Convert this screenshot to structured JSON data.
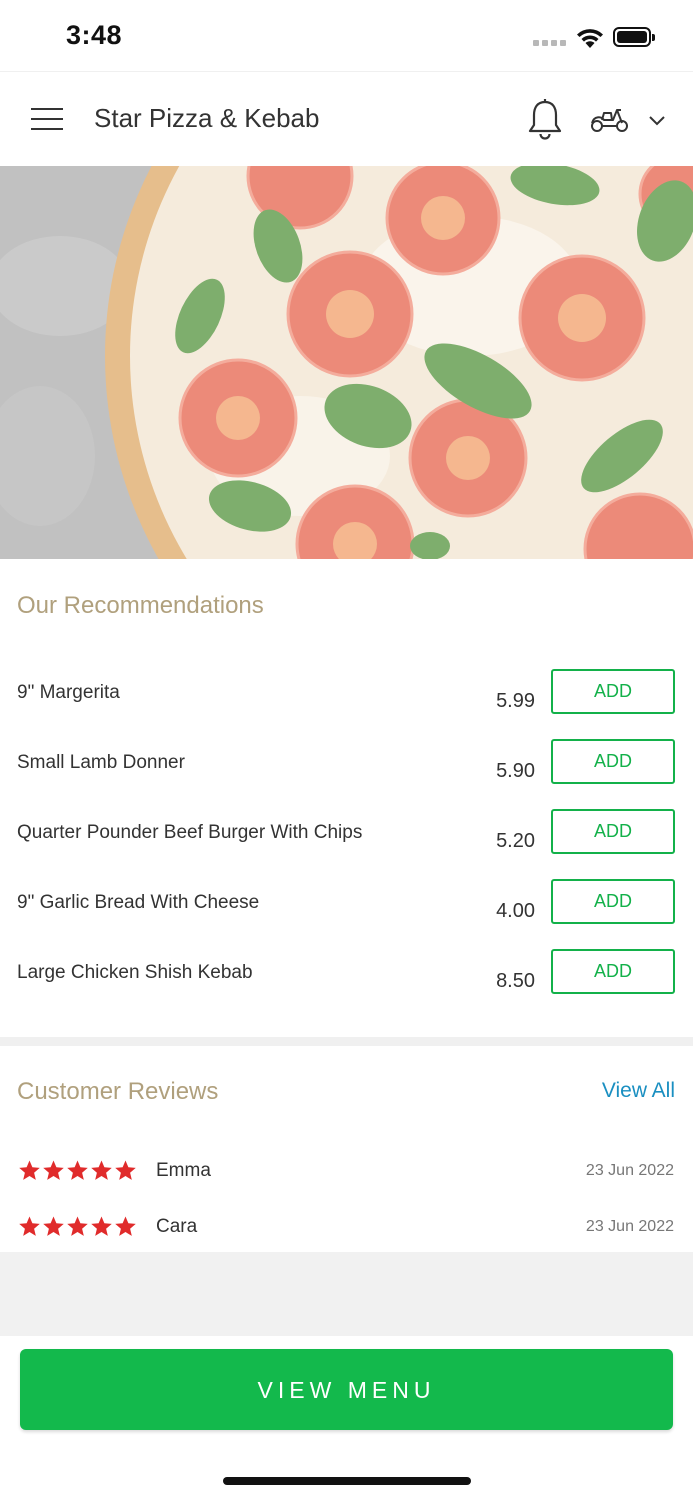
{
  "status_bar": {
    "time": "3:48"
  },
  "header": {
    "title": "Star Pizza & Kebab",
    "icons": [
      "menu-icon",
      "bell-icon",
      "scooter-icon",
      "chevron-down-icon"
    ]
  },
  "recommendations": {
    "title": "Our Recommendations",
    "add_label": "ADD",
    "items": [
      {
        "name": "9\" Margerita",
        "price": "5.99"
      },
      {
        "name": "Small Lamb Donner",
        "price": "5.90"
      },
      {
        "name": "Quarter Pounder Beef Burger With Chips",
        "price": "5.20"
      },
      {
        "name": "9\" Garlic Bread With Cheese",
        "price": "4.00"
      },
      {
        "name": "Large Chicken Shish Kebab",
        "price": "8.50"
      }
    ]
  },
  "reviews": {
    "title": "Customer Reviews",
    "view_all": "View All",
    "items": [
      {
        "rating": 5,
        "name": "Emma",
        "date": "23 Jun 2022"
      },
      {
        "rating": 5,
        "name": "Cara",
        "date": "23 Jun 2022"
      }
    ]
  },
  "footer": {
    "view_menu": "VIEW MENU"
  },
  "colors": {
    "accent_green": "#13b94c",
    "section_title": "#b0a07d",
    "link_blue": "#1a8fc1",
    "star_red": "#e02b2b"
  }
}
